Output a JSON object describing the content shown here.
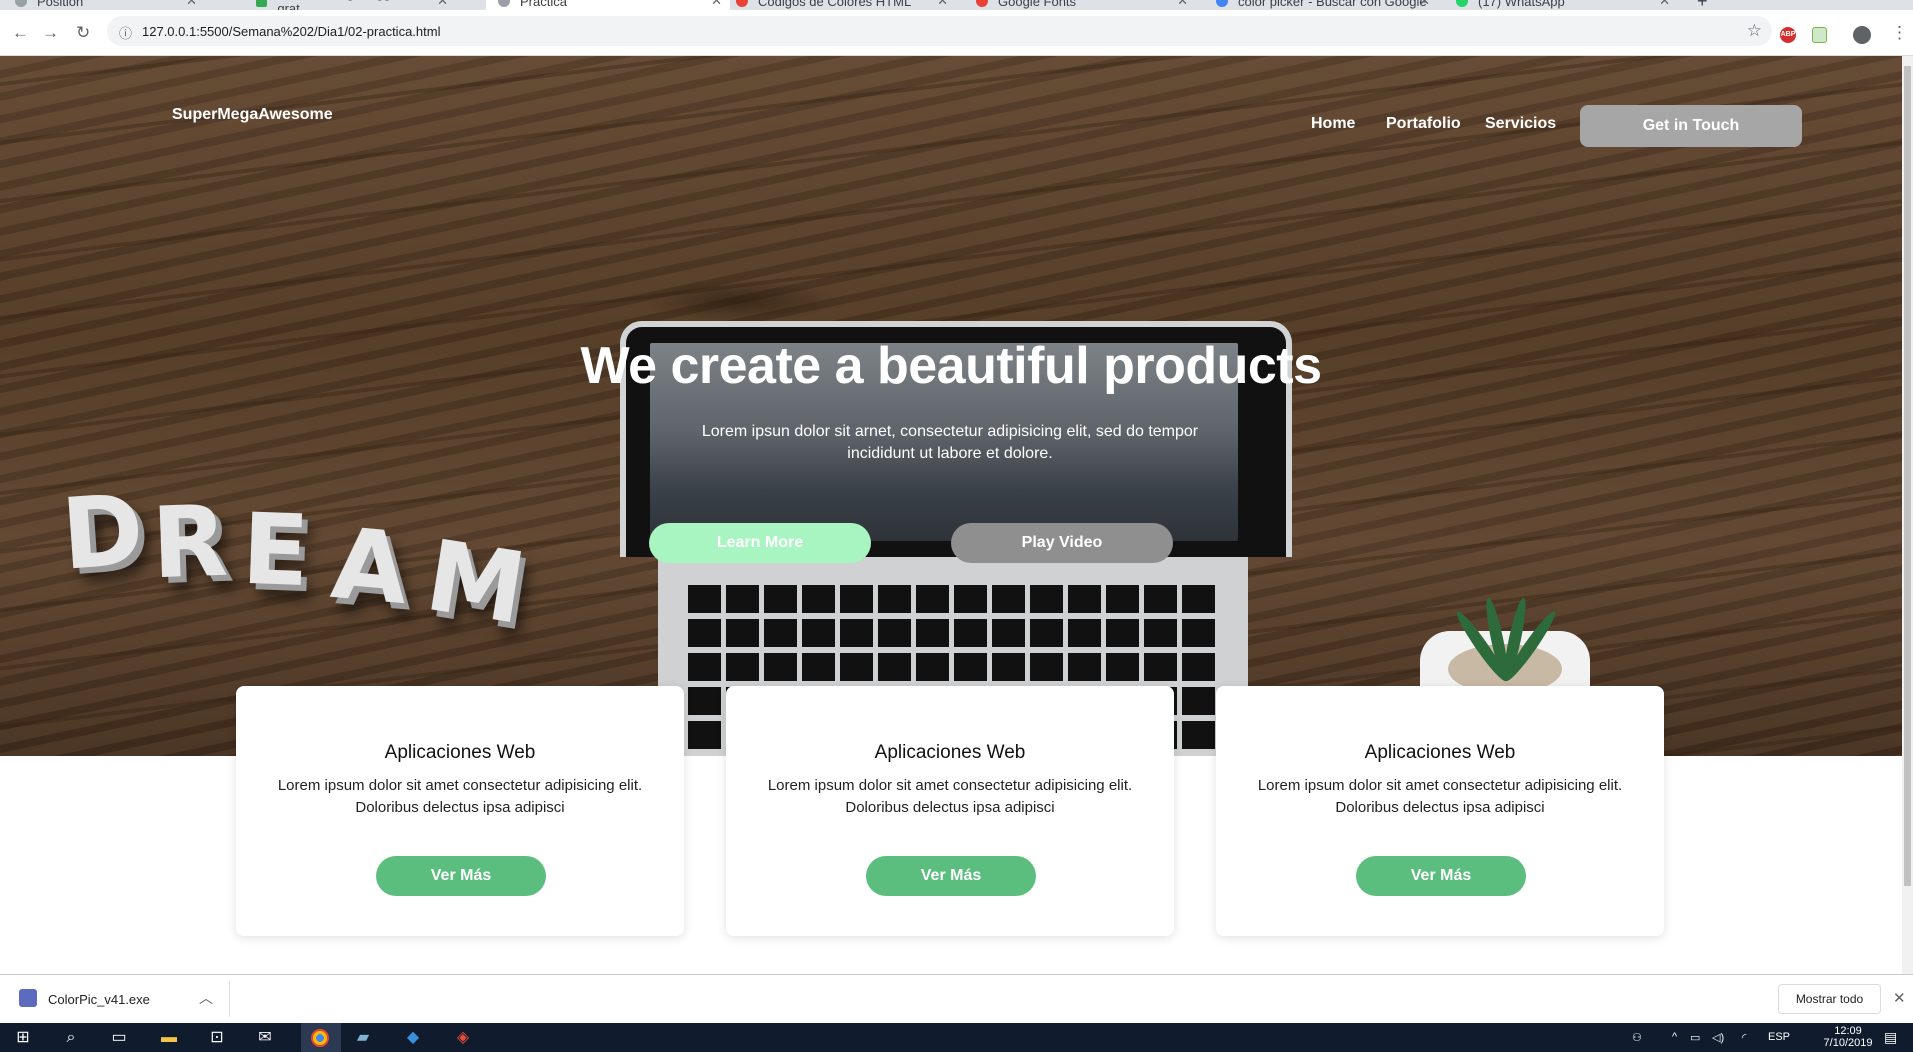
{
  "browser": {
    "tabs": [
      {
        "title": "Position",
        "favicon_color": "#9aa0a6"
      },
      {
        "title": "Bebidas Blog Blogger - Foto grat",
        "favicon_color": "#34a853"
      },
      {
        "title": "Practica",
        "favicon_color": "#9aa0a6"
      },
      {
        "title": "Codigos de Colores HTML",
        "favicon_color": "#ea4335"
      },
      {
        "title": "Google Fonts",
        "favicon_color": "#ea4335"
      },
      {
        "title": "color picker - Buscar con Google",
        "favicon_color": "#4285f4"
      },
      {
        "title": "(17) WhatsApp",
        "favicon_color": "#25d366"
      }
    ],
    "active_tab_index": 2,
    "url": "127.0.0.1:5500/Semana%202/Dia1/02-practica.html",
    "abp_label": "ABP"
  },
  "page": {
    "brand": "SuperMegaAwesome",
    "nav": {
      "home": "Home",
      "portfolio": "Portafolio",
      "services": "Servicios",
      "cta": "Get in Touch"
    },
    "hero": {
      "title": "We create a beautiful products",
      "subtitle": "Lorem ipsun dolor sit arnet, consectetur adipisicing elit, sed do tempor incididunt ut labore et dolore.",
      "learn_more": "Learn More",
      "play_video": "Play Video",
      "decor_letters": [
        "D",
        "R",
        "E",
        "A",
        "M"
      ]
    },
    "cards": [
      {
        "title": "Aplicaciones Web",
        "text": "Lorem ipsum dolor sit amet consectetur adipisicing elit. Doloribus delectus ipsa adipisci",
        "button": "Ver Más"
      },
      {
        "title": "Aplicaciones Web",
        "text": "Lorem ipsum dolor sit amet consectetur adipisicing elit. Doloribus delectus ipsa adipisci",
        "button": "Ver Más"
      },
      {
        "title": "Aplicaciones Web",
        "text": "Lorem ipsum dolor sit amet consectetur adipisicing elit. Doloribus delectus ipsa adipisci",
        "button": "Ver Más"
      }
    ],
    "colors": {
      "learn_more_bg": "#a8f5c2",
      "play_video_bg": "#8f8f8f",
      "card_button_bg": "#5bbd7e",
      "cta_bg": "#a6a6a6"
    }
  },
  "download_shelf": {
    "file": "ColorPic_v41.exe",
    "show_all": "Mostrar todo"
  },
  "taskbar": {
    "language": "ESP",
    "time": "12:09",
    "date": "7/10/2019"
  }
}
